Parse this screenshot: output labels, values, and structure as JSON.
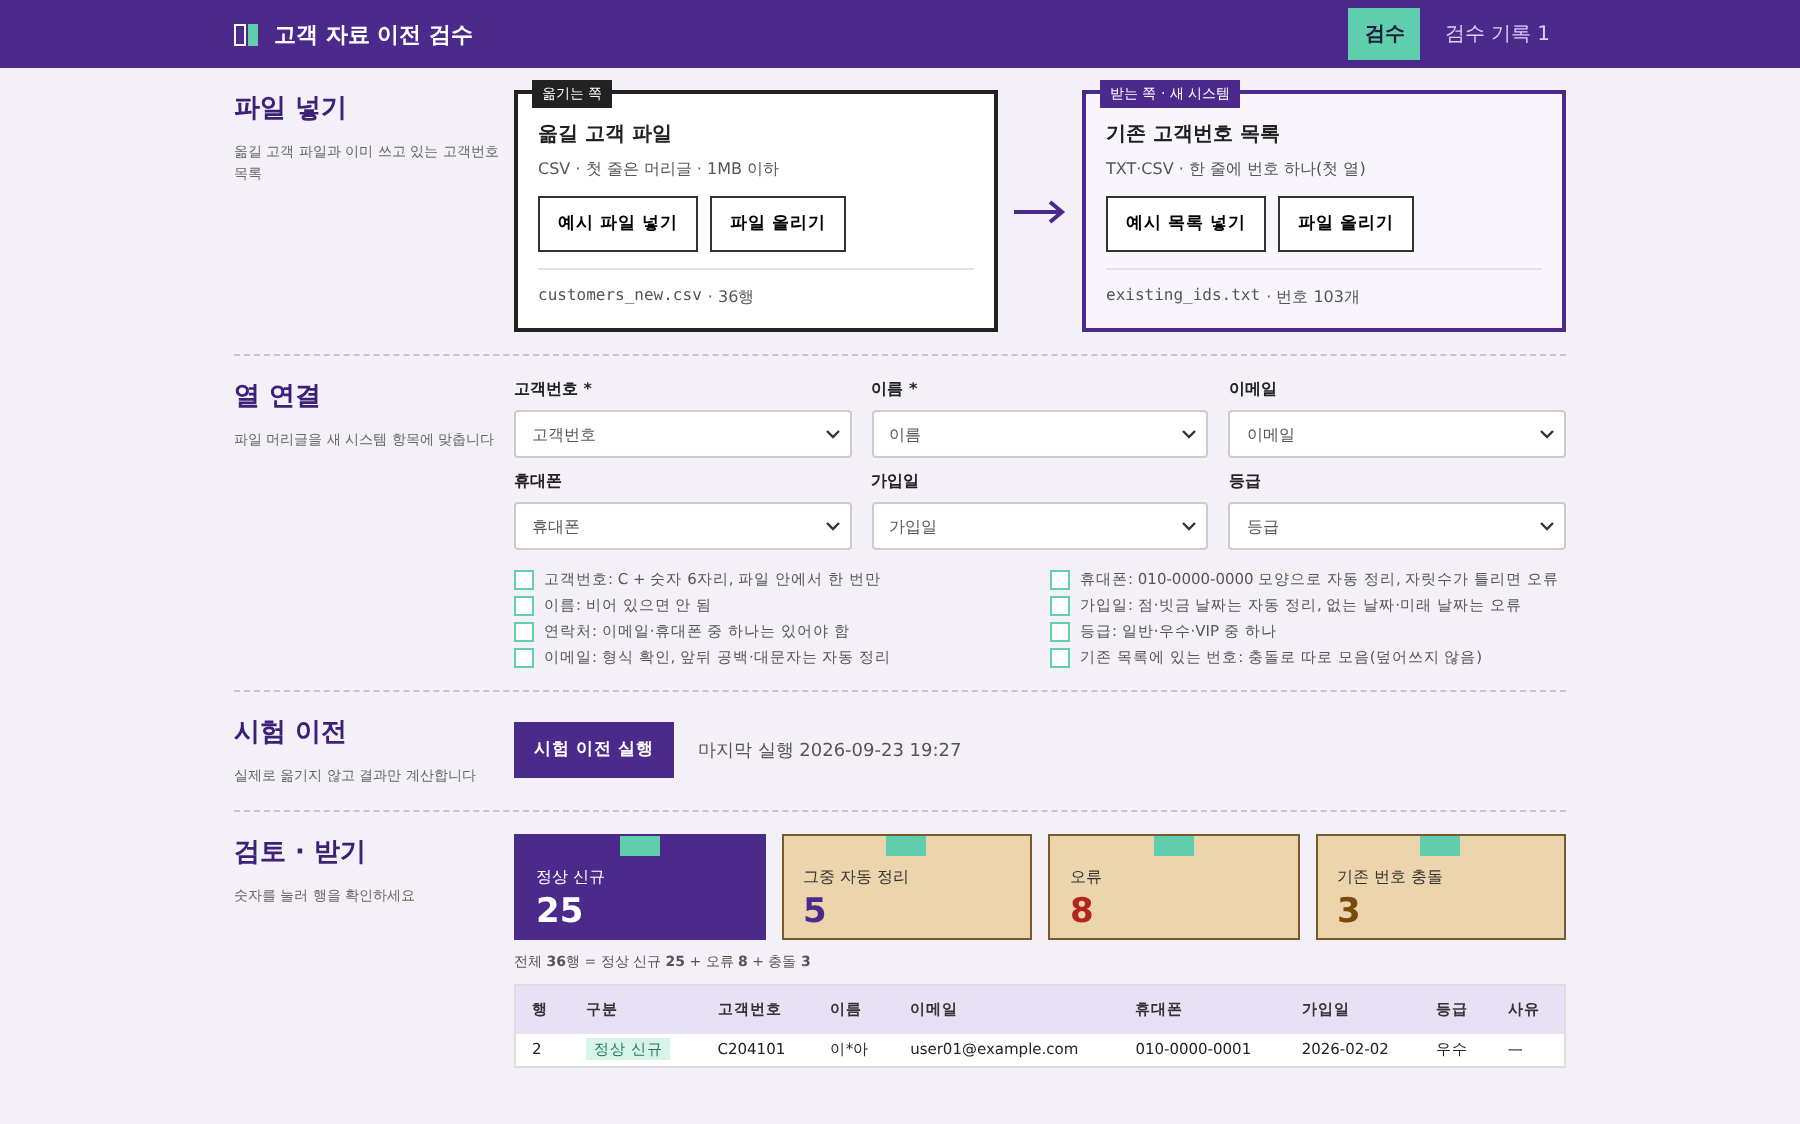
{
  "header": {
    "title": "고객 자료 이전 검수",
    "tabs": [
      {
        "label": "검수",
        "selected": true
      },
      {
        "label": "검수 기록 1",
        "selected": false
      }
    ]
  },
  "upload": {
    "title": "파일 넣기",
    "description": "옮길 고객 파일과 이미 쓰고 있는 고객번호 목록",
    "cards": [
      {
        "tag": "옮기는 쪽",
        "title": "옮길 고객 파일",
        "hint": "CSV · 첫 줄은 머리글 · 1MB 이하",
        "buttons": [
          "예시 파일 넣기",
          "파일 올리기"
        ],
        "file_name": "customers_new.csv",
        "file_info": "· 36행",
        "kind": "source"
      },
      {
        "tag": "받는 쪽 · 새 시스템",
        "title": "기존 고객번호 목록",
        "hint": "TXT·CSV · 한 줄에 번호 하나(첫 열)",
        "buttons": [
          "예시 목록 넣기",
          "파일 올리기"
        ],
        "file_name": "existing_ids.txt",
        "file_info": "· 번호 103개",
        "kind": "target"
      }
    ]
  },
  "mapping": {
    "title": "열 연결",
    "description": "파일 머리글을 새 시스템 항목에 맞춥니다",
    "fields": [
      {
        "label": "고객번호 *",
        "value": "고객번호"
      },
      {
        "label": "이름 *",
        "value": "이름"
      },
      {
        "label": "이메일",
        "value": "이메일"
      },
      {
        "label": "휴대폰",
        "value": "휴대폰"
      },
      {
        "label": "가입일",
        "value": "가입일"
      },
      {
        "label": "등급",
        "value": "등급"
      }
    ],
    "rules": [
      {
        "text": "고객번호: C + 숫자 6자리, 파일 안에서 한 번만",
        "checked": false
      },
      {
        "text": "이름: 비어 있으면 안 됨",
        "checked": false
      },
      {
        "text": "연락처: 이메일·휴대폰 중 하나는 있어야 함",
        "checked": false
      },
      {
        "text": "이메일: 형식 확인, 앞뒤 공백·대문자는 자동 정리",
        "checked": false
      },
      {
        "text": "휴대폰: 010-0000-0000 모양으로 자동 정리, 자릿수가 틀리면 오류",
        "checked": false
      },
      {
        "text": "가입일: 점·빗금 날짜는 자동 정리, 없는 날짜·미래 날짜는 오류",
        "checked": false
      },
      {
        "text": "등급: 일반·우수·VIP 중 하나",
        "checked": false
      },
      {
        "text": "기존 목록에 있는 번호: 충돌로 따로 모음(덮어쓰지 않음)",
        "checked": false
      }
    ]
  },
  "trial": {
    "title": "시험 이전",
    "description": "실제로 옮기지 않고 결과만 계산합니다",
    "button": "시험 이전 실행",
    "last_run": "마지막 실행 2026-09-23 19:27"
  },
  "review": {
    "title": "검토 · 받기",
    "description": "숫자를 눌러 행을 확인하세요",
    "stats": [
      {
        "label": "정상 신규",
        "value": "25",
        "selected": true,
        "color": "#ffffff"
      },
      {
        "label": "그중 자동 정리",
        "value": "5",
        "selected": false,
        "color": "#4a2a8c"
      },
      {
        "label": "오류",
        "value": "8",
        "selected": false,
        "color": "#b3261e"
      },
      {
        "label": "기존 번호 충돌",
        "value": "3",
        "selected": false,
        "color": "#7a4a0a"
      }
    ],
    "summary": "전체 **36**행 = 정상 신규 **25** + 오류 **8** + 충돌 **3**",
    "table": {
      "columns": [
        "행",
        "구분",
        "고객번호",
        "이름",
        "이메일",
        "휴대폰",
        "가입일",
        "등급",
        "사유"
      ],
      "rows": [
        {
          "cells": [
            "2",
            "정상 신규",
            "C204101",
            "이*아",
            "user01@example.com",
            "010-0000-0001",
            "2026-02-02",
            "우수",
            "—"
          ]
        }
      ]
    }
  }
}
